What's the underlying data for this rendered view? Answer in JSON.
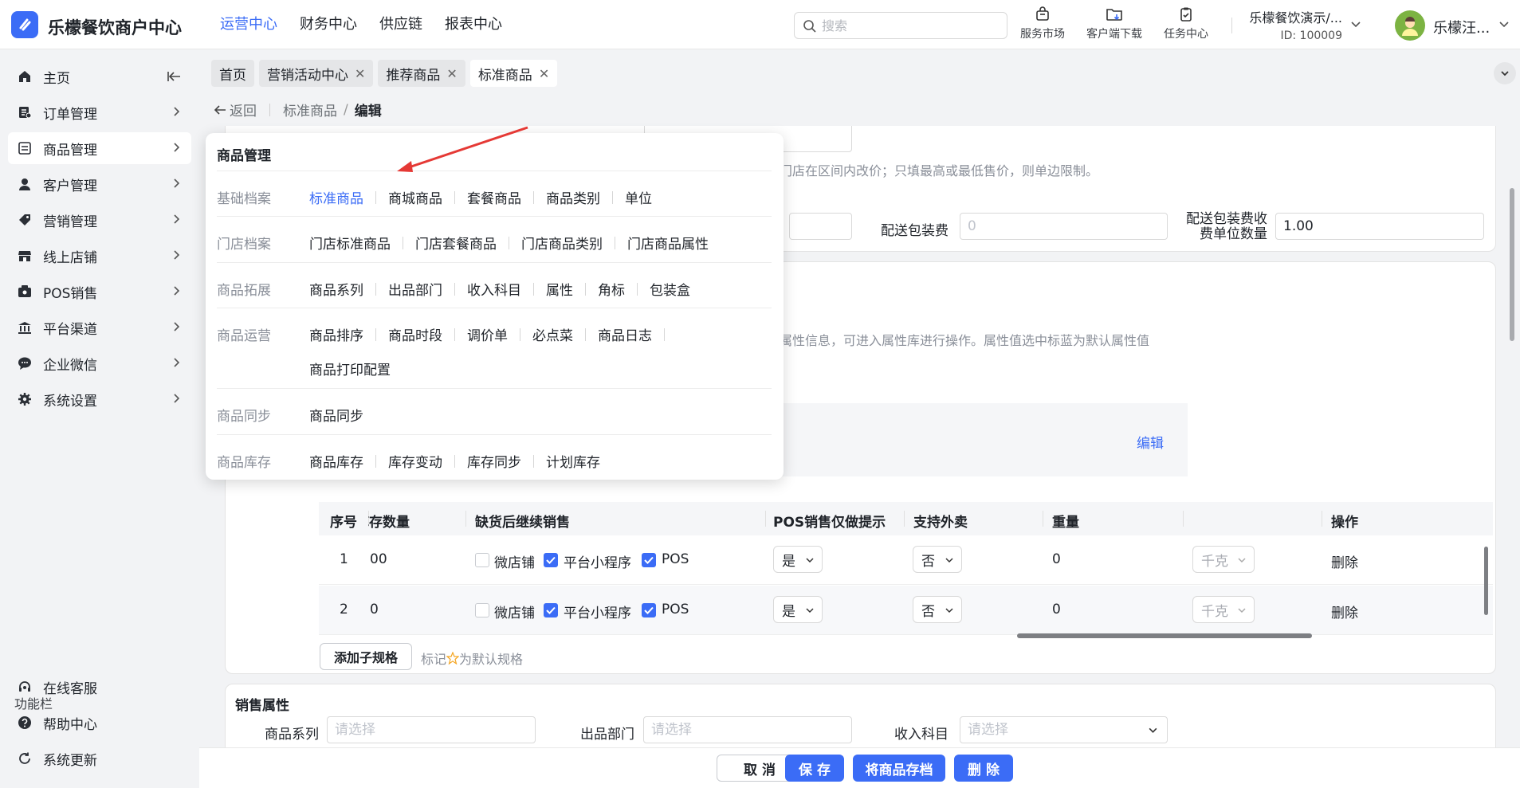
{
  "app": {
    "brand": "乐檬餐饮商户中心",
    "nav": [
      "运营中心",
      "财务中心",
      "供应链",
      "报表中心"
    ],
    "nav_active": 0,
    "search_placeholder": "搜索",
    "tools": [
      {
        "label": "服务市场",
        "icon": "shop-bag-icon"
      },
      {
        "label": "客户端下载",
        "icon": "download-folder-icon"
      },
      {
        "label": "任务中心",
        "icon": "clipboard-check-icon"
      }
    ],
    "account_name": "乐檬餐饮演示/...",
    "account_id": "ID: 100009",
    "username": "乐檬汪...",
    "accent_color": "#3b6cf6"
  },
  "sidebar": {
    "items": [
      {
        "label": "主页",
        "icon": "home-icon"
      },
      {
        "label": "订单管理",
        "icon": "order-icon"
      },
      {
        "label": "商品管理",
        "icon": "product-icon"
      },
      {
        "label": "客户管理",
        "icon": "user-icon"
      },
      {
        "label": "营销管理",
        "icon": "tag-icon"
      },
      {
        "label": "线上店铺",
        "icon": "store-icon"
      },
      {
        "label": "POS销售",
        "icon": "pos-icon"
      },
      {
        "label": "平台渠道",
        "icon": "bank-icon"
      },
      {
        "label": "企业微信",
        "icon": "chat-icon"
      },
      {
        "label": "系统设置",
        "icon": "gear-icon"
      }
    ],
    "active_index": 2,
    "func_title": "功能栏",
    "func_items": [
      {
        "label": "在线客服",
        "icon": "headset-icon"
      },
      {
        "label": "帮助中心",
        "icon": "help-icon"
      },
      {
        "label": "系统更新",
        "icon": "refresh-icon"
      }
    ]
  },
  "tabs": [
    {
      "label": "首页",
      "closable": false
    },
    {
      "label": "营销活动中心",
      "closable": true
    },
    {
      "label": "推荐商品",
      "closable": true
    },
    {
      "label": "标准商品",
      "closable": true
    }
  ],
  "breadcrumb": {
    "back": "返回",
    "parent": "标准商品",
    "separator": "/",
    "current": "编辑"
  },
  "form": {
    "price_hint": "门店在区间内改价；只填最高或最低售价，则单边限制。",
    "delivery_fee_label": "配送包装费",
    "delivery_fee_placeholder": "0",
    "delivery_unit_label_1": "配送包装费收",
    "delivery_unit_label_2": "费单位数量",
    "delivery_unit_value": "1.00",
    "attr_hint": "属性信息，可进入属性库进行操作。属性值选中标蓝为默认属性值",
    "edit_link": "编辑"
  },
  "table": {
    "headers": [
      "序号",
      "库存数量",
      "缺货后继续销售",
      "POS销售仅做提示",
      "支持外卖",
      "重量",
      "",
      "操作"
    ],
    "rows": [
      {
        "index": "1",
        "stock": "00",
        "weishop": "微店铺",
        "miniapp": "平台小程序",
        "pos": "POS",
        "weishop_checked": false,
        "miniapp_checked": true,
        "pos_checked": true,
        "pos_hint": "是",
        "takeaway": "否",
        "weight": "0",
        "unit": "千克",
        "action": "删除"
      },
      {
        "index": "2",
        "stock": "0",
        "weishop": "微店铺",
        "miniapp": "平台小程序",
        "pos": "POS",
        "weishop_checked": false,
        "miniapp_checked": true,
        "pos_checked": true,
        "pos_hint": "是",
        "takeaway": "否",
        "weight": "0",
        "unit": "千克",
        "action": "删除"
      }
    ],
    "add_spec_button": "添加子规格",
    "default_hint_pre": "标记",
    "default_hint_post": "为默认规格"
  },
  "sales": {
    "title": "销售属性",
    "series_label": "商品系列",
    "series_placeholder": "请选择",
    "dept_label": "出品部门",
    "dept_placeholder": "请选择",
    "income_label": "收入科目",
    "income_placeholder": "请选择"
  },
  "footer": {
    "cancel": "取 消",
    "save": "保 存",
    "archive": "将商品存档",
    "delete": "删 除"
  },
  "dropdown": {
    "title": "商品管理",
    "groups": [
      {
        "label": "基础档案",
        "items": [
          "标准商品",
          "商城商品",
          "套餐商品",
          "商品类别",
          "单位"
        ],
        "highlight": 0
      },
      {
        "label": "门店档案",
        "items": [
          "门店标准商品",
          "门店套餐商品",
          "门店商品类别",
          "门店商品属性"
        ]
      },
      {
        "label": "商品拓展",
        "items": [
          "商品系列",
          "出品部门",
          "收入科目",
          "属性",
          "角标",
          "包装盒"
        ]
      },
      {
        "label": "商品运营",
        "items": [
          "商品排序",
          "商品时段",
          "调价单",
          "必点菜",
          "商品日志"
        ],
        "items_line2": [
          "商品打印配置"
        ]
      },
      {
        "label": "商品同步",
        "items": [
          "商品同步"
        ]
      },
      {
        "label": "商品库存",
        "items": [
          "商品库存",
          "库存变动",
          "库存同步",
          "计划库存"
        ]
      }
    ]
  }
}
